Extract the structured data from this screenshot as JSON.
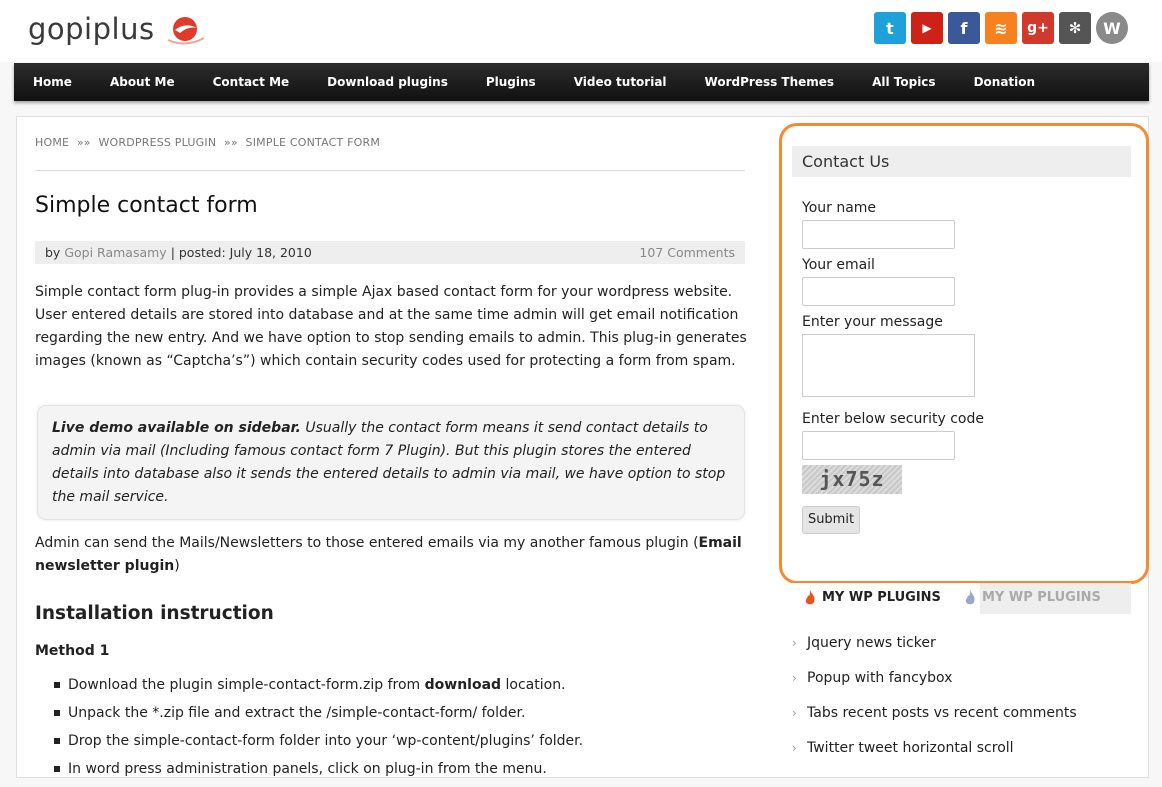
{
  "header": {
    "logo_text": "gopiplus",
    "social_icons": [
      {
        "name": "twitter-icon",
        "glyph": "t",
        "color": "#1da1d8"
      },
      {
        "name": "youtube-icon",
        "glyph": "▶",
        "color": "#cc2218"
      },
      {
        "name": "facebook-icon",
        "glyph": "f",
        "color": "#3b5998"
      },
      {
        "name": "rss-icon",
        "glyph": "≋",
        "color": "#f7811e"
      },
      {
        "name": "google-plus-icon",
        "glyph": "g+",
        "color": "#d0392b"
      },
      {
        "name": "joomla-icon",
        "glyph": "✻",
        "color": "#3a7c2a"
      },
      {
        "name": "wordpress-icon",
        "glyph": "W",
        "color": "#7a7a7a"
      }
    ]
  },
  "nav": {
    "items": [
      "Home",
      "About Me",
      "Contact Me",
      "Download plugins",
      "Plugins",
      "Video tutorial",
      "WordPress Themes",
      "All Topics",
      "Donation"
    ]
  },
  "breadcrumb": {
    "home": "HOME",
    "sep": "»»",
    "section": "WORDPRESS PLUGIN",
    "current": "SIMPLE CONTACT FORM"
  },
  "post": {
    "title": "Simple contact form",
    "meta_by": "by",
    "author": "Gopi Ramasamy",
    "posted": "| posted: July 18, 2010",
    "comments": "107 Comments",
    "intro": "Simple contact form plug-in provides a simple Ajax based contact form for your wordpress website. User entered details are stored into database and at the same time admin will get email notification regarding the new entry. And we have option to stop sending emails to admin. This plug-in generates images (known as “Captcha’s”) which contain security codes used for protecting a form from spam.",
    "quote_bold": "Live demo available on sidebar.",
    "quote_rest": " Usually the contact form means it send contact details to admin via mail (Including famous contact form 7 Plugin). But this plugin stores the entered details into database also it sends the entered details to admin via mail, we have option to stop the mail service.",
    "newsletter_pre": "Admin can send the Mails/Newsletters to those entered emails via my another famous plugin (",
    "newsletter_bold": "Email newsletter plugin",
    "newsletter_post": ")",
    "install_heading": "Installation instruction",
    "method_heading": "Method 1",
    "steps": [
      {
        "pre": "Download the plugin simple-contact-form.zip from ",
        "bold": "download",
        "post": " location."
      },
      {
        "pre": "Unpack the *.zip file and extract the /simple-contact-form/ folder.",
        "bold": "",
        "post": ""
      },
      {
        "pre": "Drop the simple-contact-form folder into your ‘wp-content/plugins’ folder.",
        "bold": "",
        "post": ""
      },
      {
        "pre": "In word press administration panels, click on plug-in from the menu.",
        "bold": "",
        "post": ""
      }
    ]
  },
  "contact_widget": {
    "title": "Contact Us",
    "name_label": "Your name",
    "email_label": "Your email",
    "message_label": "Enter your message",
    "security_label": "Enter below security code",
    "captcha_text": "jx75z",
    "submit_label": "Submit"
  },
  "plugins_widget": {
    "tab1": "MY WP PLUGINS",
    "tab2": "MY WP PLUGINS",
    "items": [
      "Jquery news ticker",
      "Popup with fancybox",
      "Tabs recent posts vs recent comments",
      "Twitter tweet horizontal scroll"
    ]
  },
  "colors": {
    "highlight_border": "#f48a32",
    "nav_bg": "#1a1a1a"
  }
}
